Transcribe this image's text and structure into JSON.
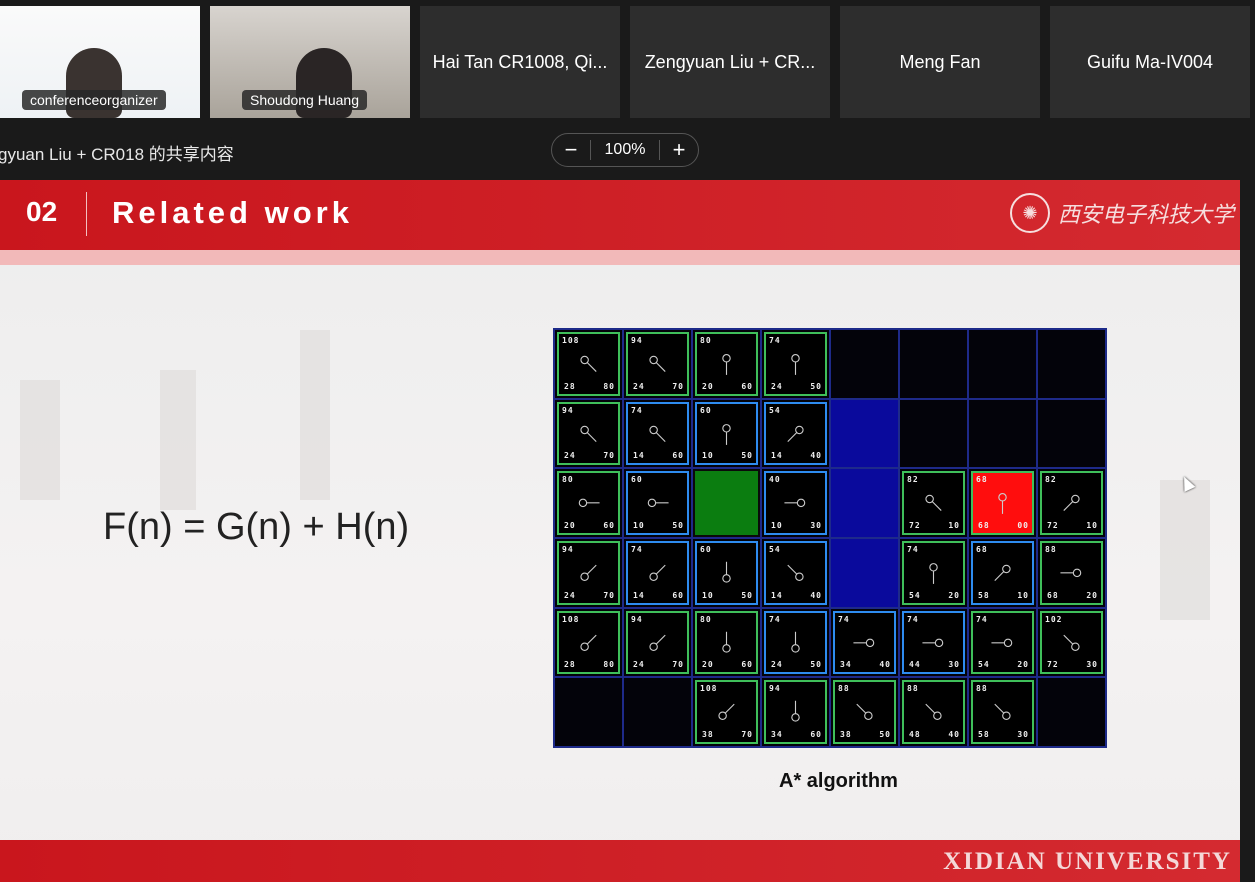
{
  "participants": [
    {
      "name": "conferenceorganizer",
      "video": true
    },
    {
      "name": "Shoudong Huang",
      "video": true
    },
    {
      "name": "Hai Tan CR1008, Qi..."
    },
    {
      "name": "Zengyuan Liu + CR..."
    },
    {
      "name": "Meng Fan"
    },
    {
      "name": "Guifu Ma-IV004"
    }
  ],
  "share_label": "gyuan Liu + CR018 的共享内容",
  "zoom": {
    "minus": "−",
    "value": "100%",
    "plus": "+"
  },
  "slide": {
    "number": "02",
    "title": "Related work",
    "logo_text": "西安电子科技大学",
    "formula": "F(n) = G(n)  + H(n)",
    "caption": "A* algorithm",
    "footer": "XIDIAN UNIVERSITY"
  },
  "grid": {
    "colors": {
      "open": "#3fbf5a",
      "closed": "#2e8cf0",
      "wall": "#0a0a9c",
      "start": "#0b7d10",
      "goal": "#ff0d0d"
    },
    "rows": [
      [
        {
          "t": "open",
          "f": "108",
          "g": "28",
          "h": "80",
          "d": "se"
        },
        {
          "t": "open",
          "f": "94",
          "g": "24",
          "h": "70",
          "d": "se"
        },
        {
          "t": "open",
          "f": "80",
          "g": "20",
          "h": "60",
          "d": "s"
        },
        {
          "t": "open",
          "f": "74",
          "g": "24",
          "h": "50",
          "d": "s"
        },
        {
          "t": "empty"
        },
        {
          "t": "empty"
        },
        {
          "t": "empty"
        },
        {
          "t": "empty"
        }
      ],
      [
        {
          "t": "open",
          "f": "94",
          "g": "24",
          "h": "70",
          "d": "se"
        },
        {
          "t": "closed",
          "f": "74",
          "g": "14",
          "h": "60",
          "d": "se"
        },
        {
          "t": "closed",
          "f": "60",
          "g": "10",
          "h": "50",
          "d": "s"
        },
        {
          "t": "closed",
          "f": "54",
          "g": "14",
          "h": "40",
          "d": "sw"
        },
        {
          "t": "wall"
        },
        {
          "t": "empty"
        },
        {
          "t": "empty"
        },
        {
          "t": "empty"
        }
      ],
      [
        {
          "t": "open",
          "f": "80",
          "g": "20",
          "h": "60",
          "d": "e"
        },
        {
          "t": "closed",
          "f": "60",
          "g": "10",
          "h": "50",
          "d": "e"
        },
        {
          "t": "start"
        },
        {
          "t": "closed",
          "f": "40",
          "g": "10",
          "h": "30",
          "d": "w"
        },
        {
          "t": "wall"
        },
        {
          "t": "open",
          "f": "82",
          "g": "72",
          "h": "10",
          "d": "se"
        },
        {
          "t": "goal",
          "f": "68",
          "g": "68",
          "h": "00",
          "d": "s"
        },
        {
          "t": "open",
          "f": "82",
          "g": "72",
          "h": "10",
          "d": "sw"
        }
      ],
      [
        {
          "t": "open",
          "f": "94",
          "g": "24",
          "h": "70",
          "d": "ne"
        },
        {
          "t": "closed",
          "f": "74",
          "g": "14",
          "h": "60",
          "d": "ne"
        },
        {
          "t": "closed",
          "f": "60",
          "g": "10",
          "h": "50",
          "d": "n"
        },
        {
          "t": "closed",
          "f": "54",
          "g": "14",
          "h": "40",
          "d": "nw"
        },
        {
          "t": "wall"
        },
        {
          "t": "open",
          "f": "74",
          "g": "54",
          "h": "20",
          "d": "s"
        },
        {
          "t": "closed",
          "f": "68",
          "g": "58",
          "h": "10",
          "d": "sw"
        },
        {
          "t": "open",
          "f": "88",
          "g": "68",
          "h": "20",
          "d": "w"
        }
      ],
      [
        {
          "t": "open",
          "f": "108",
          "g": "28",
          "h": "80",
          "d": "ne"
        },
        {
          "t": "open",
          "f": "94",
          "g": "24",
          "h": "70",
          "d": "ne"
        },
        {
          "t": "open",
          "f": "80",
          "g": "20",
          "h": "60",
          "d": "n"
        },
        {
          "t": "closed",
          "f": "74",
          "g": "24",
          "h": "50",
          "d": "n"
        },
        {
          "t": "closed",
          "f": "74",
          "g": "34",
          "h": "40",
          "d": "w"
        },
        {
          "t": "closed",
          "f": "74",
          "g": "44",
          "h": "30",
          "d": "w"
        },
        {
          "t": "open",
          "f": "74",
          "g": "54",
          "h": "20",
          "d": "w"
        },
        {
          "t": "open",
          "f": "102",
          "g": "72",
          "h": "30",
          "d": "nw"
        }
      ],
      [
        {
          "t": "empty"
        },
        {
          "t": "empty"
        },
        {
          "t": "open",
          "f": "108",
          "g": "38",
          "h": "70",
          "d": "ne"
        },
        {
          "t": "open",
          "f": "94",
          "g": "34",
          "h": "60",
          "d": "n"
        },
        {
          "t": "open",
          "f": "88",
          "g": "38",
          "h": "50",
          "d": "nw"
        },
        {
          "t": "open",
          "f": "88",
          "g": "48",
          "h": "40",
          "d": "nw"
        },
        {
          "t": "open",
          "f": "88",
          "g": "58",
          "h": "30",
          "d": "nw"
        },
        {
          "t": "empty"
        }
      ]
    ]
  }
}
